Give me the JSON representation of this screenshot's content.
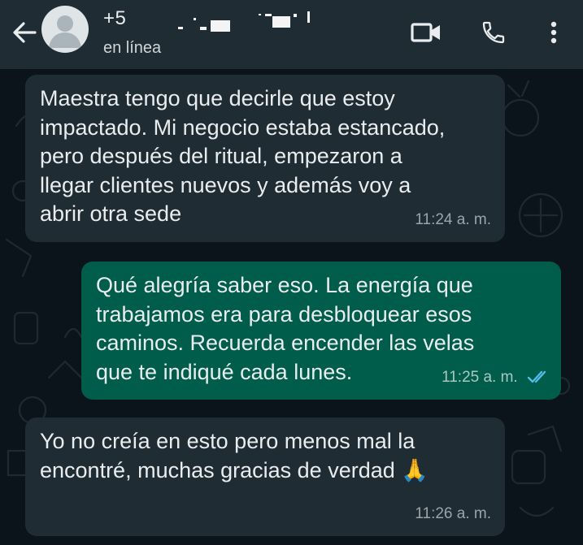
{
  "header": {
    "contact_name": "+5",
    "status": "en línea",
    "back_icon": "arrow-left-icon",
    "video_icon": "video-camera-icon",
    "call_icon": "phone-icon",
    "menu_icon": "more-vertical-icon"
  },
  "colors": {
    "header_bg": "#1f2c33",
    "chat_bg": "#0b141a",
    "incoming_bubble": "#1f2c33",
    "outgoing_bubble": "#005c4b",
    "read_ticks": "#53bdeb"
  },
  "messages": [
    {
      "direction": "incoming",
      "lines": [
        "Maestra tengo que decirle que estoy",
        "impactado. Mi negocio estaba estancado,",
        "pero después del ritual, empezaron a",
        "llegar clientes nuevos y además voy a",
        "abrir otra sede"
      ],
      "time": "11:24 a. m."
    },
    {
      "direction": "outgoing",
      "lines": [
        "Qué alegría saber eso. La energía que",
        "trabajamos era para desbloquear esos",
        "caminos. Recuerda encender las velas",
        "que te indiqué cada lunes."
      ],
      "time": "11:25 a. m.",
      "status_icon": "double-check-read-icon"
    },
    {
      "direction": "incoming",
      "lines": [
        "Yo no creía en esto pero menos mal la",
        "encontré, muchas gracias de verdad 🙏"
      ],
      "time": "11:26 a. m."
    }
  ]
}
